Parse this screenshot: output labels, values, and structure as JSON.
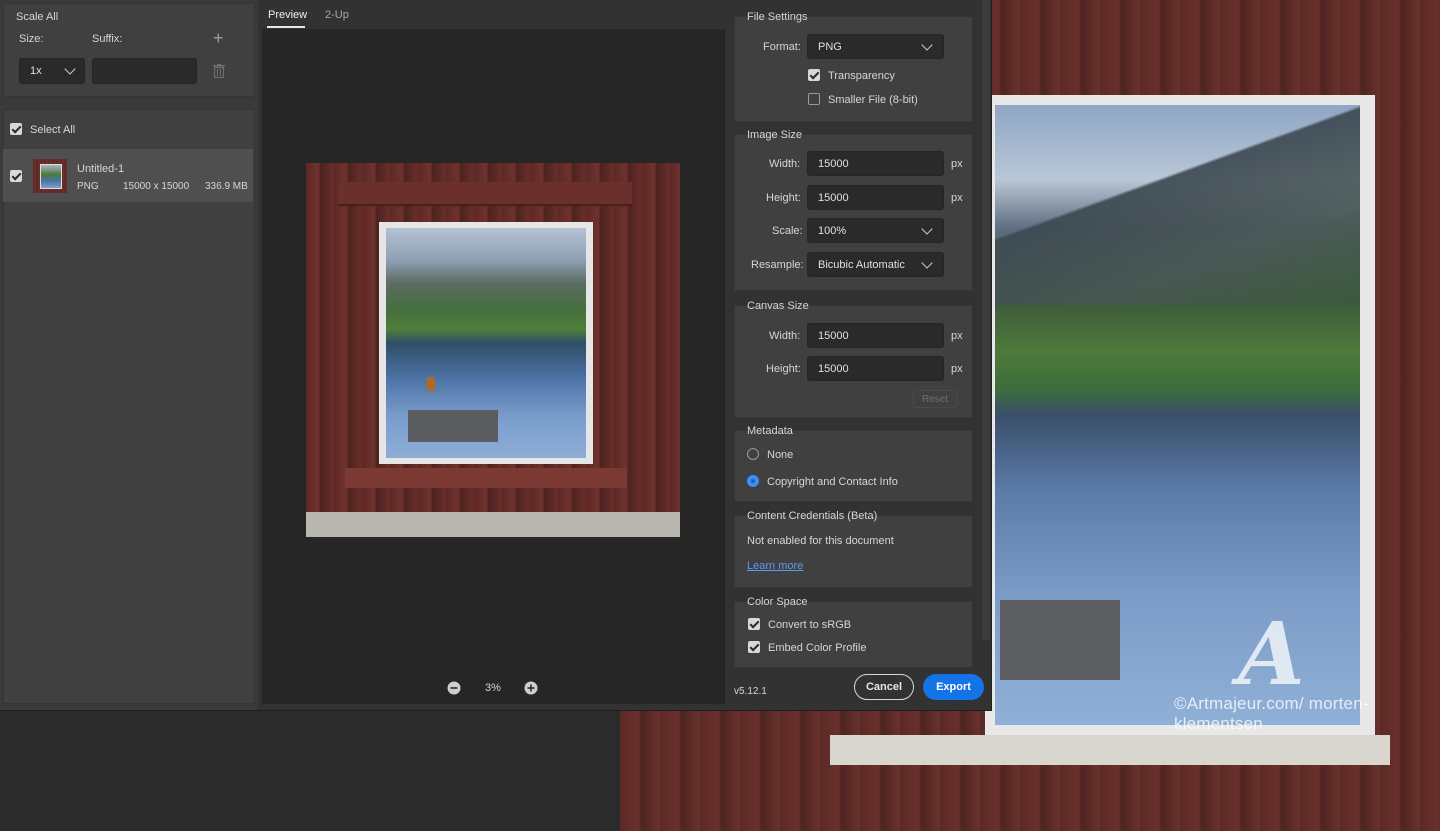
{
  "scale_panel": {
    "title": "Scale All",
    "size_label": "Size:",
    "suffix_label": "Suffix:",
    "size_value": "1x",
    "suffix_value": "",
    "add_icon": "plus-icon",
    "delete_icon": "trash-icon"
  },
  "asset_list": {
    "select_all_label": "Select All",
    "select_all_checked": true,
    "items": [
      {
        "name": "Untitled-1",
        "format": "PNG",
        "dimensions": "15000 x 15000",
        "size": "336.9 MB",
        "checked": true
      }
    ]
  },
  "tabs": [
    {
      "label": "Preview",
      "active": true
    },
    {
      "label": "2-Up",
      "active": false
    }
  ],
  "zoom": {
    "value": "3%",
    "zoom_out_icon": "minus-circle-icon",
    "zoom_in_icon": "plus-circle-icon"
  },
  "file_settings": {
    "title": "File Settings",
    "format_label": "Format:",
    "format_value": "PNG",
    "transparency_label": "Transparency",
    "transparency_checked": true,
    "smaller_file_label": "Smaller File (8-bit)",
    "smaller_file_checked": false
  },
  "image_size": {
    "title": "Image Size",
    "width_label": "Width:",
    "width_value": "15000",
    "height_label": "Height:",
    "height_value": "15000",
    "scale_label": "Scale:",
    "scale_value": "100%",
    "resample_label": "Resample:",
    "resample_value": "Bicubic Automatic",
    "unit": "px"
  },
  "canvas_size": {
    "title": "Canvas Size",
    "width_label": "Width:",
    "width_value": "15000",
    "height_label": "Height:",
    "height_value": "15000",
    "unit": "px",
    "reset_label": "Reset"
  },
  "metadata": {
    "title": "Metadata",
    "options": [
      {
        "label": "None",
        "selected": false
      },
      {
        "label": "Copyright and Contact Info",
        "selected": true
      }
    ]
  },
  "content_credentials": {
    "title": "Content Credentials (Beta)",
    "status": "Not enabled for this document",
    "learn_more": "Learn more"
  },
  "color_space": {
    "title": "Color Space",
    "convert_label": "Convert to sRGB",
    "convert_checked": true,
    "embed_label": "Embed Color Profile",
    "embed_checked": true
  },
  "footer": {
    "version": "v5.12.1",
    "cancel_label": "Cancel",
    "export_label": "Export"
  },
  "watermark": {
    "text": "©Artmajeur.com/ morten-klementsen"
  },
  "colors": {
    "accent": "#1473e6",
    "link": "#5a9bf0"
  }
}
